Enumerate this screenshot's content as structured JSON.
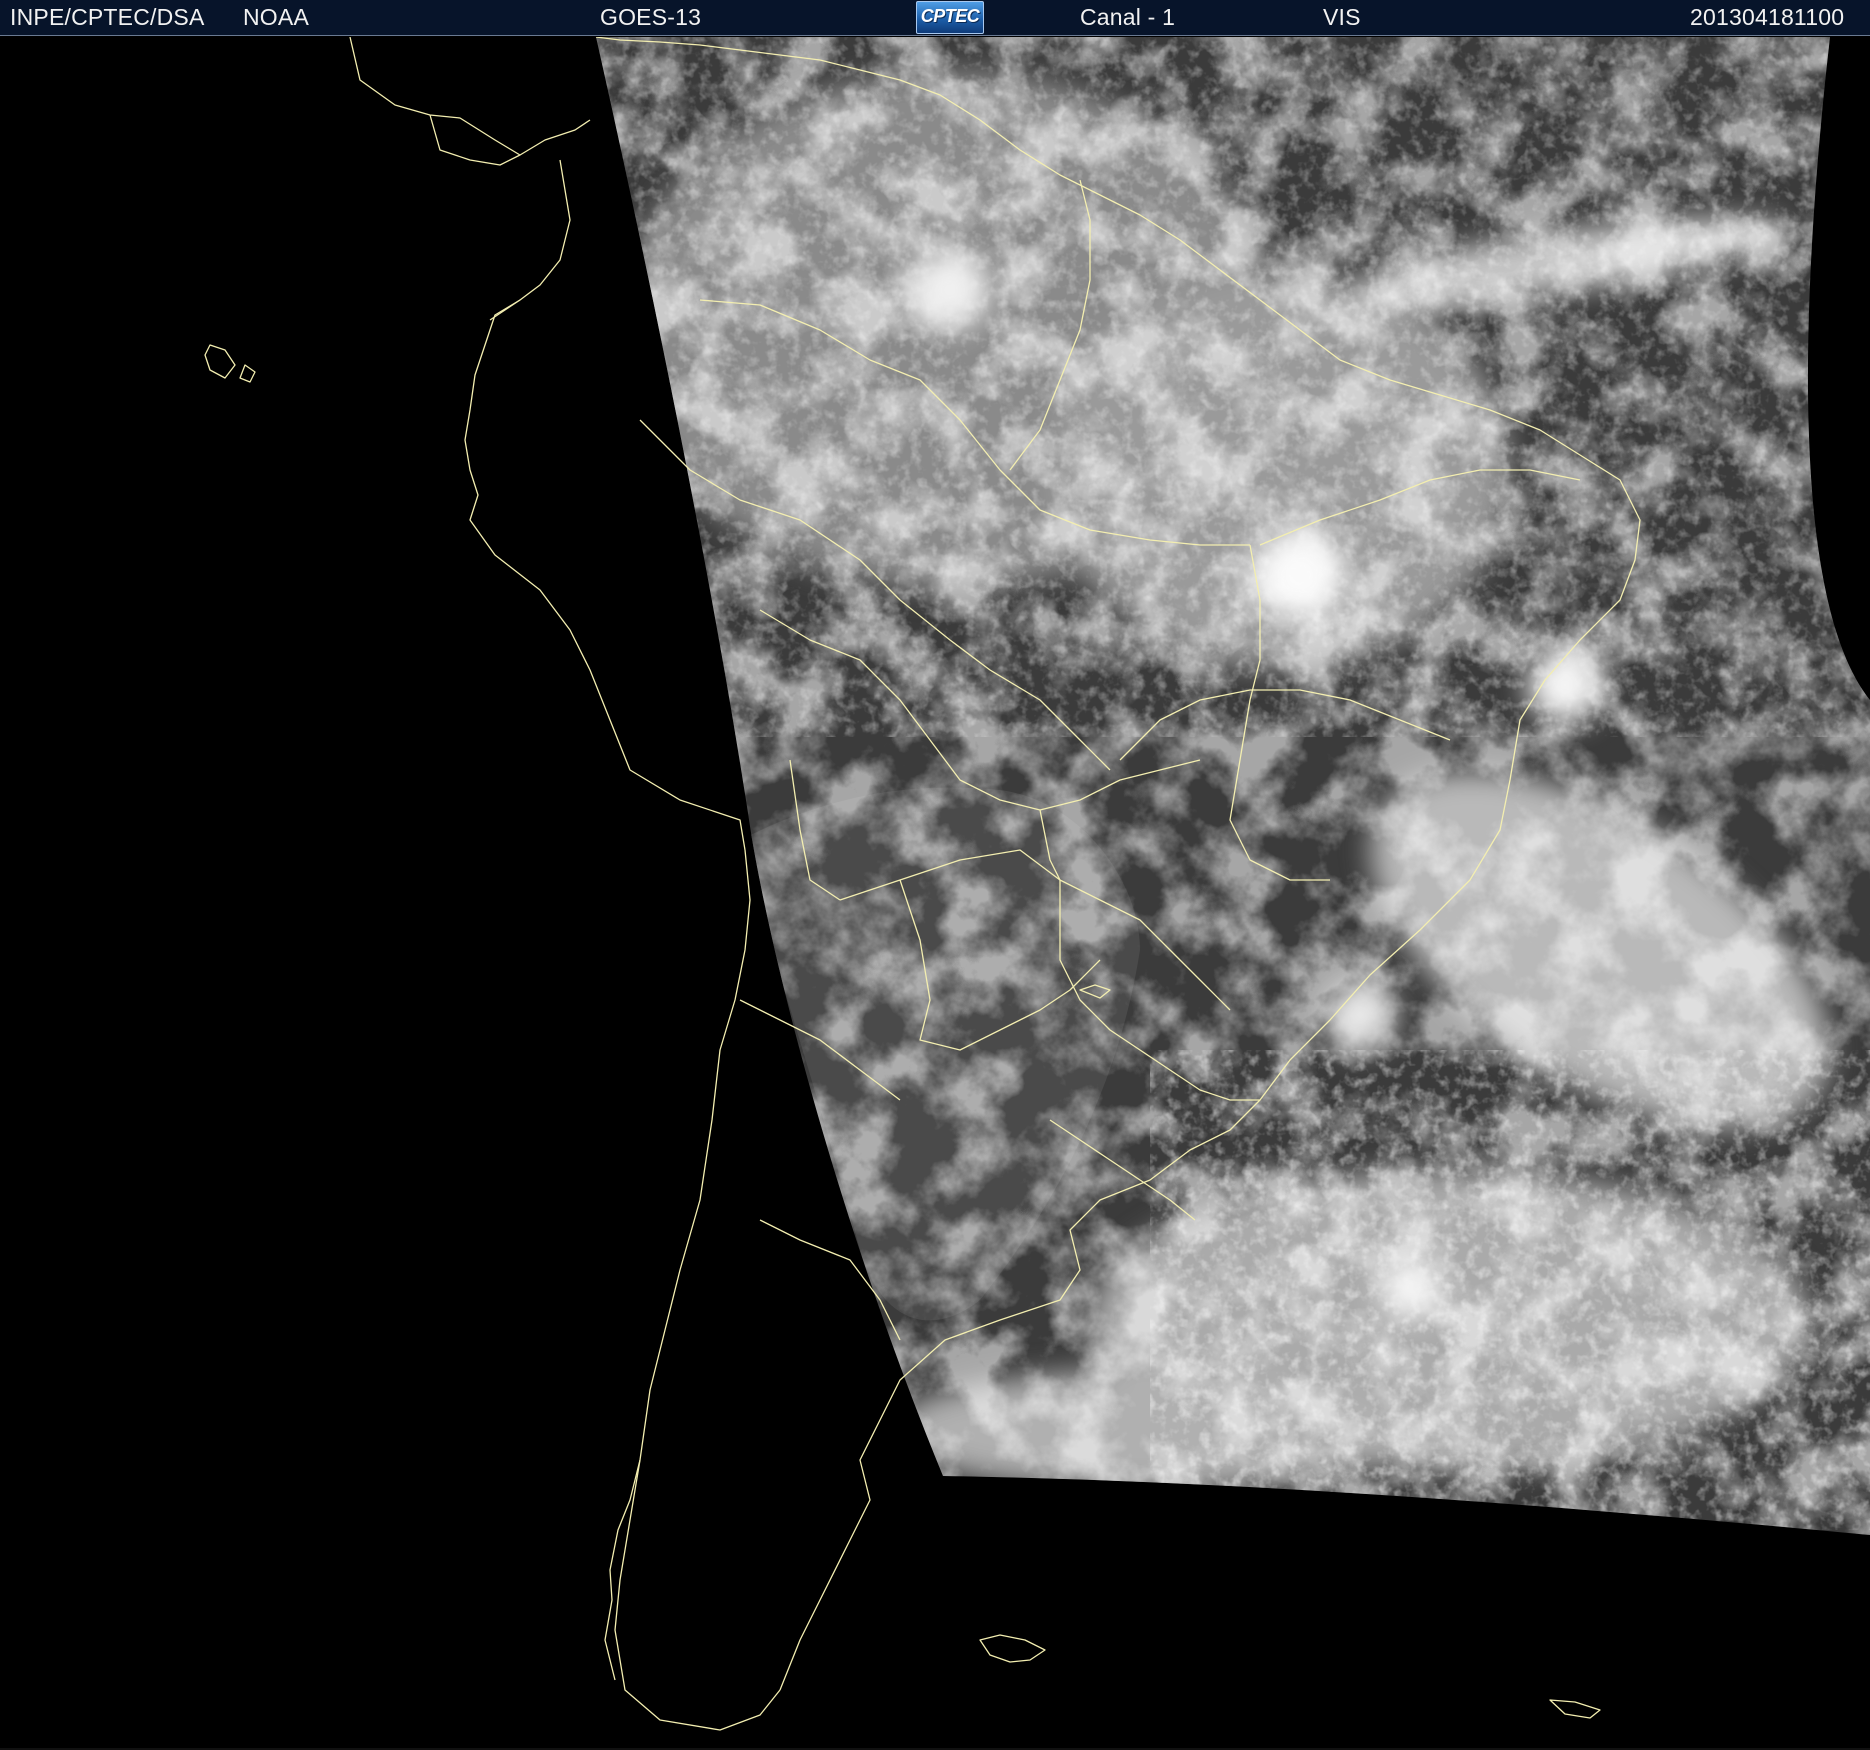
{
  "header": {
    "institution": "INPE/CPTEC/DSA",
    "agency": "NOAA",
    "satellite": "GOES-13",
    "logo_text": "CPTEC",
    "channel": "Canal - 1",
    "band": "VIS",
    "timestamp": "201304181100"
  },
  "colors": {
    "header_background": "#07142a",
    "header_text": "#f2f2f2",
    "boundary_lines": "#f3eeb0",
    "space_background": "#000000",
    "ocean_gray": "#3a3a3a",
    "cloud_white": "#e8e8e8"
  },
  "image": {
    "type": "satellite-visible-imagery",
    "region": "South America"
  }
}
